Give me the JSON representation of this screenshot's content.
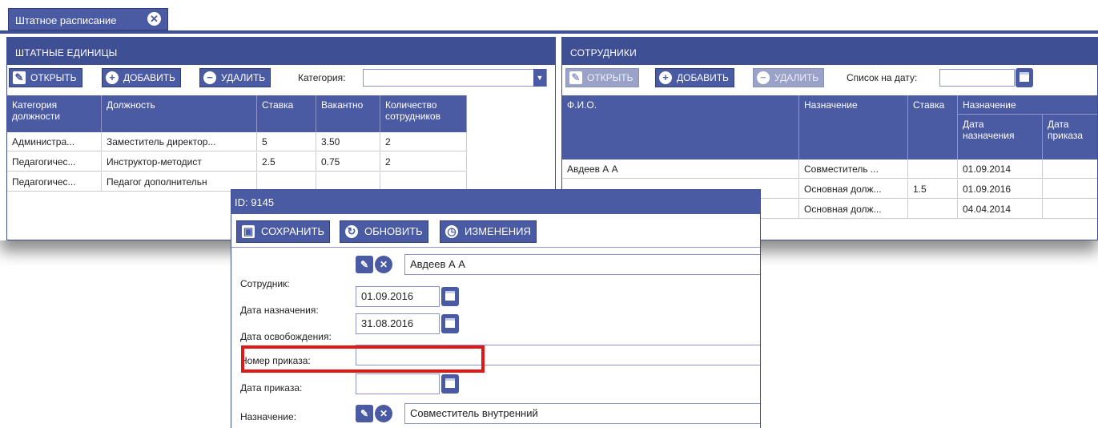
{
  "tab": {
    "title": "Штатное расписание"
  },
  "staff_units": {
    "title": "ШТАТНЫЕ ЕДИНИЦЫ",
    "open_label": "ОТКРЫТЬ",
    "add_label": "ДОБАВИТЬ",
    "delete_label": "УДАЛИТЬ",
    "category_label": "Категория:",
    "category_value": "",
    "columns": [
      "Категория должности",
      "Должность",
      "Ставка",
      "Вакантно",
      "Количество сотрудников"
    ],
    "rows": [
      [
        "Администра...",
        "Заместитель директор...",
        "5",
        "3.50",
        "2"
      ],
      [
        "Педагогичес...",
        "Инструктор-методист",
        "2.5",
        "0.75",
        "2"
      ],
      [
        "Педагогичес...",
        "Педагог дополнительн",
        "",
        "",
        ""
      ]
    ]
  },
  "employees": {
    "title": "СОТРУДНИКИ",
    "open_label": "ОТКРЫТЬ",
    "add_label": "ДОБАВИТЬ",
    "delete_label": "УДАЛИТЬ",
    "date_list_label": "Список на дату:",
    "date_list_value": "",
    "columns": {
      "fio": "Ф.И.О.",
      "assignment": "Назначение",
      "rate": "Ставка",
      "group": "Назначение",
      "date_assigned": "Дата назначения",
      "order_date": "Дата приказа"
    },
    "rows": [
      [
        "Авдеев А А",
        "Совместитель ...",
        "",
        "01.09.2014"
      ],
      [
        "",
        "Основная долж...",
        "1.5",
        "01.09.2016"
      ],
      [
        "",
        "Основная долж...",
        "",
        "04.04.2014"
      ]
    ]
  },
  "dialog": {
    "title": "ID: 9145",
    "save_label": "СОХРАНИТЬ",
    "refresh_label": "ОБНОВИТЬ",
    "changes_label": "ИЗМЕНЕНИЯ",
    "employee_label": "Сотрудник:",
    "employee_value": "Авдеев А А",
    "date_assigned_label": "Дата назначения:",
    "date_assigned_value": "01.09.2016",
    "date_released_label": "Дата освобождения:",
    "date_released_value": "31.08.2016",
    "order_number_label": "Номер приказа:",
    "order_number_value": "",
    "order_date_label": "Дата приказа:",
    "order_date_value": "",
    "assignment_label": "Назначение:",
    "assignment_value": "Совместитель внутренний"
  },
  "colors": {
    "header": "#3e4f94",
    "button": "#4a5aa3",
    "highlight": "#e01818"
  },
  "icons": [
    "close-icon",
    "edit-icon",
    "plus-icon",
    "minus-icon",
    "calendar-icon",
    "save-icon",
    "refresh-icon",
    "history-icon",
    "clear-icon",
    "dropdown-icon"
  ]
}
